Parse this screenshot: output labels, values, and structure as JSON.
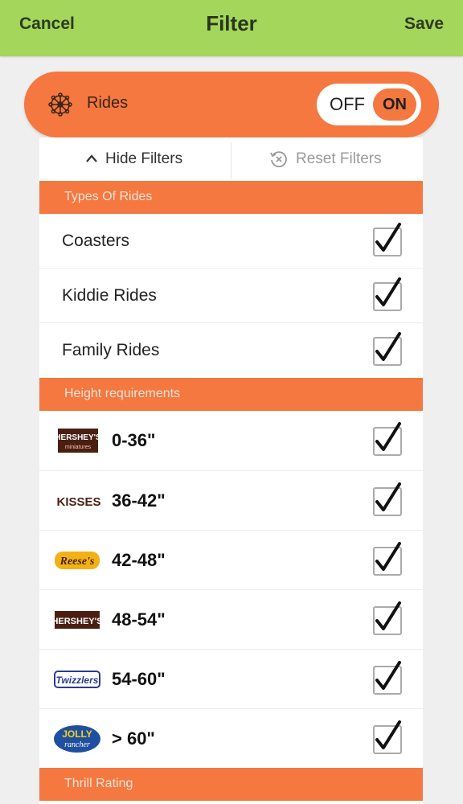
{
  "header": {
    "cancel_label": "Cancel",
    "title": "Filter",
    "save_label": "Save"
  },
  "rides": {
    "label": "Rides",
    "toggle_off": "OFF",
    "toggle_on": "ON",
    "toggle_state": "on"
  },
  "filter_bar": {
    "hide_label": "Hide Filters",
    "reset_label": "Reset Filters"
  },
  "sections": {
    "types": "Types Of Rides",
    "height": "Height requirements",
    "thrill": "Thrill Rating"
  },
  "ride_types": [
    {
      "label": "Coasters",
      "checked": true
    },
    {
      "label": "Kiddie Rides",
      "checked": true
    },
    {
      "label": "Family Rides",
      "checked": true
    }
  ],
  "heights": [
    {
      "label": "0-36\"",
      "logo": "HERSHEY'S",
      "logo_sub": "miniatures",
      "logo_icon": "hersheys-miniatures-logo",
      "checked": true
    },
    {
      "label": "36-42\"",
      "logo": "KISSES",
      "logo_icon": "kisses-logo",
      "checked": true
    },
    {
      "label": "42-48\"",
      "logo": "Reese's",
      "logo_icon": "reeses-logo",
      "checked": true
    },
    {
      "label": "48-54\"",
      "logo": "HERSHEY'S",
      "logo_icon": "hersheys-logo",
      "checked": true
    },
    {
      "label": "54-60\"",
      "logo": "Twizzlers",
      "logo_icon": "twizzlers-logo",
      "checked": true
    },
    {
      "label": "> 60\"",
      "logo": "JOLLY",
      "logo_sub": "rancher",
      "logo_icon": "jolly-rancher-logo",
      "checked": true
    }
  ],
  "colors": {
    "green": "#a3d65b",
    "orange": "#f47840",
    "background": "#efefef"
  }
}
